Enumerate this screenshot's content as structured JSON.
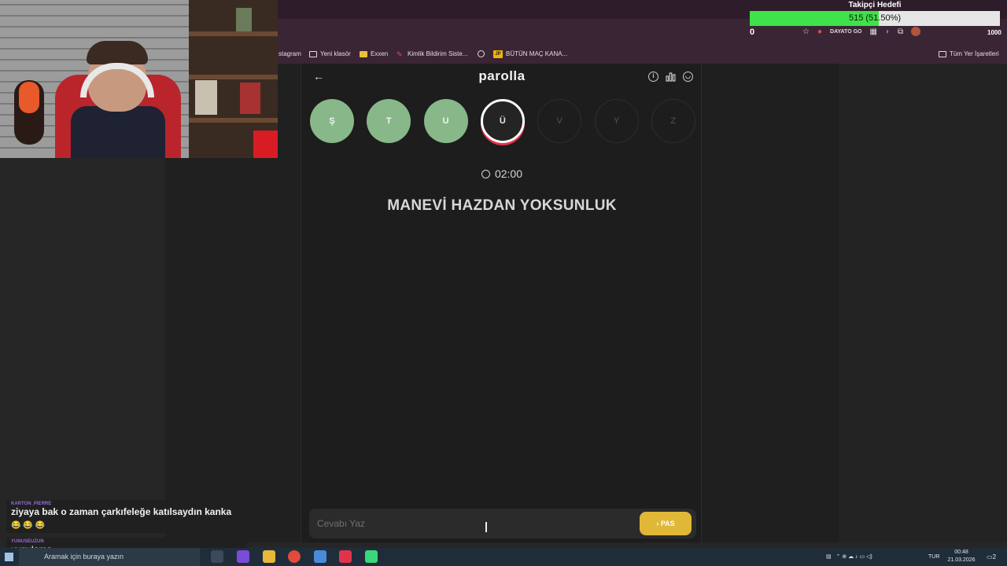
{
  "browser": {
    "bookmarks": [
      {
        "label": "stagram",
        "icon": "instagram-icon"
      },
      {
        "label": "Yeni klasör",
        "icon": "folder-icon"
      },
      {
        "label": "Exxen",
        "icon": "exxen-icon"
      },
      {
        "label": "Kimlik Bildirim Siste...",
        "icon": "tag-icon"
      },
      {
        "label": "",
        "icon": "globe-icon"
      },
      {
        "label": "BÜTÜN MAÇ KANA...",
        "icon": "jp-icon"
      }
    ],
    "all_bookmarks_label": "Tüm Yer İşaretleri",
    "extension_label": "DAYATO GO",
    "extension_count": "1000"
  },
  "follower_goal": {
    "title": "Takipçi Hedefi",
    "progress_text": "515 (51.50%)",
    "progress_fraction": 0.515,
    "start": "0",
    "end": "1000"
  },
  "game": {
    "logo": "parolla",
    "letters": [
      {
        "char": "Ş",
        "state": "done"
      },
      {
        "char": "T",
        "state": "done"
      },
      {
        "char": "U",
        "state": "done"
      },
      {
        "char": "Ü",
        "state": "active"
      },
      {
        "char": "V",
        "state": "pending"
      },
      {
        "char": "Y",
        "state": "pending"
      },
      {
        "char": "Z",
        "state": "pending"
      }
    ],
    "timer": "02:00",
    "question": "MANEVİ HAZDAN YOKSUNLUK",
    "answer_placeholder": "Cevabı Yaz",
    "pass_label": "PAS",
    "colors": {
      "done": "#88b889",
      "active_border": "#e2334b",
      "pass_button": "#e0b736"
    }
  },
  "chat": [
    {
      "user": "KARTON_PIERRE",
      "text": "ziyaya bak o zaman çarkıfeleğe katılsaydın kanka",
      "emotes": "😂 😂 😂"
    },
    {
      "user": "YUNUSEUZUN",
      "text": "uygulama"
    }
  ],
  "taskbar": {
    "search_placeholder": "Aramak için buraya yazın",
    "language": "TUR",
    "time": "00:48",
    "date": "21.03.2026",
    "notification_count": "2"
  }
}
